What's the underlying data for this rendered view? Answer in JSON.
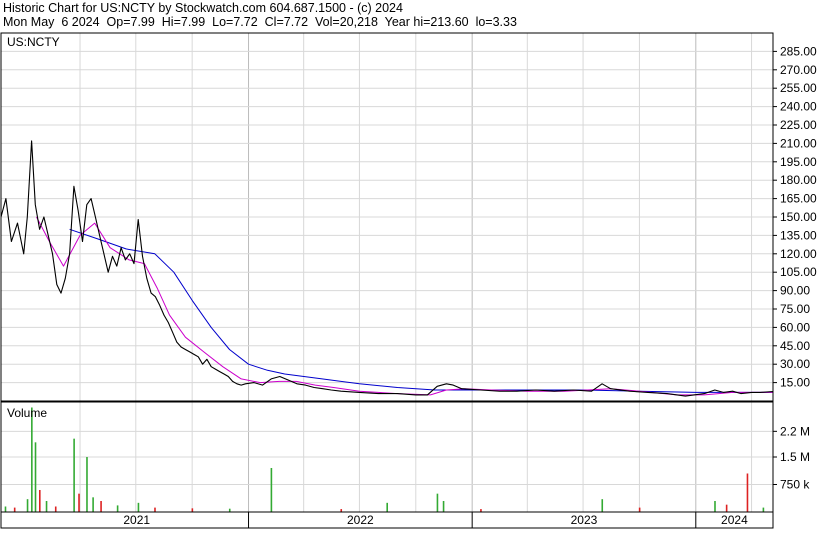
{
  "header": {
    "line1": "Historic Chart for US:NCTY by Stockwatch.com 604.687.1500 - (c) 2024",
    "line2": "Mon May  6 2024  Op=7.99  Hi=7.99  Lo=7.72  Cl=7.72  Vol=20,218  Year hi=213.60  lo=3.33"
  },
  "colors": {
    "price_line": "#000000",
    "ma_fast": "#cc00cc",
    "ma_slow": "#0000cc",
    "volume_up": "#33aa33",
    "volume_down": "#dd2222",
    "grid": "#d8d8d8"
  },
  "chart_data": [
    {
      "type": "line",
      "panel": "price",
      "label": "US:NCTY",
      "x_range": [
        "2020-11-23",
        "2024-05-06"
      ],
      "y_range": [
        0,
        300
      ],
      "y_ticks": [
        15,
        30,
        45,
        60,
        75,
        90,
        105,
        120,
        135,
        150,
        165,
        180,
        195,
        210,
        225,
        240,
        255,
        270,
        285
      ],
      "x_labels": [
        "2021",
        "2022",
        "2023",
        "2024"
      ],
      "grid": true,
      "series": [
        {
          "role": "price",
          "points": [
            [
              "2020-11-23",
              150
            ],
            [
              "2020-12-01",
              165
            ],
            [
              "2020-12-10",
              130
            ],
            [
              "2020-12-20",
              145
            ],
            [
              "2020-12-30",
              120
            ],
            [
              "2021-01-05",
              150
            ],
            [
              "2021-01-12",
              212
            ],
            [
              "2021-01-18",
              160
            ],
            [
              "2021-01-25",
              140
            ],
            [
              "2021-02-01",
              150
            ],
            [
              "2021-02-08",
              135
            ],
            [
              "2021-02-15",
              120
            ],
            [
              "2021-02-22",
              95
            ],
            [
              "2021-03-01",
              88
            ],
            [
              "2021-03-08",
              100
            ],
            [
              "2021-03-15",
              120
            ],
            [
              "2021-03-22",
              175
            ],
            [
              "2021-03-29",
              155
            ],
            [
              "2021-04-05",
              130
            ],
            [
              "2021-04-12",
              160
            ],
            [
              "2021-04-19",
              165
            ],
            [
              "2021-04-26",
              150
            ],
            [
              "2021-05-03",
              135
            ],
            [
              "2021-05-10",
              120
            ],
            [
              "2021-05-17",
              105
            ],
            [
              "2021-05-24",
              118
            ],
            [
              "2021-05-31",
              110
            ],
            [
              "2021-06-07",
              125
            ],
            [
              "2021-06-14",
              115
            ],
            [
              "2021-06-21",
              120
            ],
            [
              "2021-06-28",
              112
            ],
            [
              "2021-07-05",
              148
            ],
            [
              "2021-07-12",
              118
            ],
            [
              "2021-07-19",
              100
            ],
            [
              "2021-07-26",
              88
            ],
            [
              "2021-08-02",
              85
            ],
            [
              "2021-08-09",
              78
            ],
            [
              "2021-08-16",
              70
            ],
            [
              "2021-08-23",
              64
            ],
            [
              "2021-08-30",
              56
            ],
            [
              "2021-09-06",
              48
            ],
            [
              "2021-09-13",
              44
            ],
            [
              "2021-09-20",
              42
            ],
            [
              "2021-09-27",
              40
            ],
            [
              "2021-10-04",
              38
            ],
            [
              "2021-10-11",
              36
            ],
            [
              "2021-10-18",
              30
            ],
            [
              "2021-10-25",
              34
            ],
            [
              "2021-11-01",
              28
            ],
            [
              "2021-11-08",
              26
            ],
            [
              "2021-11-15",
              24
            ],
            [
              "2021-11-22",
              22
            ],
            [
              "2021-11-29",
              20
            ],
            [
              "2021-12-06",
              16
            ],
            [
              "2021-12-13",
              14
            ],
            [
              "2021-12-20",
              13
            ],
            [
              "2021-12-27",
              14
            ],
            [
              "2022-01-10",
              15
            ],
            [
              "2022-01-24",
              13
            ],
            [
              "2022-02-07",
              18
            ],
            [
              "2022-02-21",
              20
            ],
            [
              "2022-03-07",
              17
            ],
            [
              "2022-03-21",
              14
            ],
            [
              "2022-04-04",
              13
            ],
            [
              "2022-04-18",
              11
            ],
            [
              "2022-05-02",
              10
            ],
            [
              "2022-05-16",
              9
            ],
            [
              "2022-06-01",
              8
            ],
            [
              "2022-07-01",
              7
            ],
            [
              "2022-08-01",
              6
            ],
            [
              "2022-09-01",
              6
            ],
            [
              "2022-10-01",
              5
            ],
            [
              "2022-10-20",
              5
            ],
            [
              "2022-11-05",
              12
            ],
            [
              "2022-11-20",
              14
            ],
            [
              "2022-12-01",
              13
            ],
            [
              "2022-12-15",
              10
            ],
            [
              "2023-01-15",
              9
            ],
            [
              "2023-02-15",
              8
            ],
            [
              "2023-03-15",
              8
            ],
            [
              "2023-04-15",
              9
            ],
            [
              "2023-05-15",
              8
            ],
            [
              "2023-06-15",
              9
            ],
            [
              "2023-07-15",
              8
            ],
            [
              "2023-08-01",
              14
            ],
            [
              "2023-08-15",
              10
            ],
            [
              "2023-09-15",
              8
            ],
            [
              "2023-10-15",
              7
            ],
            [
              "2023-11-15",
              6
            ],
            [
              "2023-12-15",
              4
            ],
            [
              "2024-01-15",
              6
            ],
            [
              "2024-02-01",
              9
            ],
            [
              "2024-02-15",
              7
            ],
            [
              "2024-03-01",
              8
            ],
            [
              "2024-03-15",
              6
            ],
            [
              "2024-04-01",
              7
            ],
            [
              "2024-04-15",
              7
            ],
            [
              "2024-05-06",
              7.72
            ]
          ]
        },
        {
          "role": "ma_fast",
          "points": [
            [
              "2021-01-20",
              150
            ],
            [
              "2021-02-10",
              130
            ],
            [
              "2021-03-05",
              110
            ],
            [
              "2021-04-01",
              135
            ],
            [
              "2021-04-25",
              145
            ],
            [
              "2021-05-20",
              125
            ],
            [
              "2021-06-20",
              115
            ],
            [
              "2021-07-15",
              112
            ],
            [
              "2021-08-05",
              92
            ],
            [
              "2021-08-25",
              70
            ],
            [
              "2021-09-20",
              52
            ],
            [
              "2021-10-20",
              40
            ],
            [
              "2021-11-20",
              28
            ],
            [
              "2021-12-20",
              18
            ],
            [
              "2022-01-20",
              15
            ],
            [
              "2022-02-20",
              16
            ],
            [
              "2022-03-20",
              16
            ],
            [
              "2022-04-20",
              13
            ],
            [
              "2022-05-20",
              11
            ],
            [
              "2022-07-01",
              8
            ],
            [
              "2022-09-01",
              6
            ],
            [
              "2022-10-25",
              5
            ],
            [
              "2022-11-20",
              9
            ],
            [
              "2022-12-20",
              10
            ],
            [
              "2023-02-01",
              9
            ],
            [
              "2023-04-01",
              8
            ],
            [
              "2023-06-01",
              8
            ],
            [
              "2023-08-15",
              10
            ],
            [
              "2023-10-01",
              8
            ],
            [
              "2023-12-01",
              5
            ],
            [
              "2024-01-15",
              5
            ],
            [
              "2024-03-01",
              7
            ],
            [
              "2024-05-06",
              7
            ]
          ]
        },
        {
          "role": "ma_slow",
          "points": [
            [
              "2021-03-15",
              140
            ],
            [
              "2021-05-01",
              132
            ],
            [
              "2021-06-15",
              124
            ],
            [
              "2021-08-01",
              120
            ],
            [
              "2021-09-01",
              105
            ],
            [
              "2021-10-01",
              82
            ],
            [
              "2021-11-01",
              60
            ],
            [
              "2021-12-01",
              42
            ],
            [
              "2022-01-01",
              30
            ],
            [
              "2022-02-01",
              25
            ],
            [
              "2022-03-01",
              22
            ],
            [
              "2022-05-01",
              18
            ],
            [
              "2022-07-01",
              14
            ],
            [
              "2022-09-01",
              11
            ],
            [
              "2022-11-01",
              9
            ],
            [
              "2023-01-01",
              9
            ],
            [
              "2023-04-01",
              9
            ],
            [
              "2023-07-01",
              9
            ],
            [
              "2023-10-01",
              8
            ],
            [
              "2024-01-01",
              7
            ],
            [
              "2024-05-06",
              7
            ]
          ]
        }
      ]
    },
    {
      "type": "bar",
      "panel": "volume",
      "label": "Volume",
      "y_range": [
        0,
        3000000
      ],
      "y_ticks": [
        750000,
        1500000,
        2200000
      ],
      "y_tick_labels": [
        "750 k",
        "1.5 M",
        "2.2 M"
      ],
      "grid": true,
      "values": [
        [
          "2020-11-30",
          150000,
          "up"
        ],
        [
          "2020-12-15",
          120000,
          "down"
        ],
        [
          "2021-01-05",
          350000,
          "up"
        ],
        [
          "2021-01-12",
          2850000,
          "up"
        ],
        [
          "2021-01-18",
          1900000,
          "up"
        ],
        [
          "2021-01-25",
          600000,
          "down"
        ],
        [
          "2021-02-05",
          300000,
          "up"
        ],
        [
          "2021-02-20",
          150000,
          "down"
        ],
        [
          "2021-03-22",
          2000000,
          "up"
        ],
        [
          "2021-03-30",
          500000,
          "down"
        ],
        [
          "2021-04-12",
          1500000,
          "up"
        ],
        [
          "2021-04-22",
          400000,
          "up"
        ],
        [
          "2021-05-05",
          300000,
          "down"
        ],
        [
          "2021-06-01",
          180000,
          "up"
        ],
        [
          "2021-07-05",
          250000,
          "up"
        ],
        [
          "2021-08-01",
          120000,
          "down"
        ],
        [
          "2021-10-01",
          100000,
          "down"
        ],
        [
          "2021-12-01",
          90000,
          "up"
        ],
        [
          "2022-02-07",
          1200000,
          "up"
        ],
        [
          "2022-06-01",
          80000,
          "down"
        ],
        [
          "2022-08-15",
          250000,
          "up"
        ],
        [
          "2022-11-05",
          500000,
          "up"
        ],
        [
          "2022-11-15",
          300000,
          "up"
        ],
        [
          "2023-01-15",
          80000,
          "down"
        ],
        [
          "2023-08-01",
          350000,
          "up"
        ],
        [
          "2023-10-01",
          120000,
          "down"
        ],
        [
          "2024-02-01",
          300000,
          "up"
        ],
        [
          "2024-02-20",
          200000,
          "down"
        ],
        [
          "2024-03-25",
          1050000,
          "down"
        ],
        [
          "2024-04-20",
          120000,
          "up"
        ]
      ]
    }
  ]
}
